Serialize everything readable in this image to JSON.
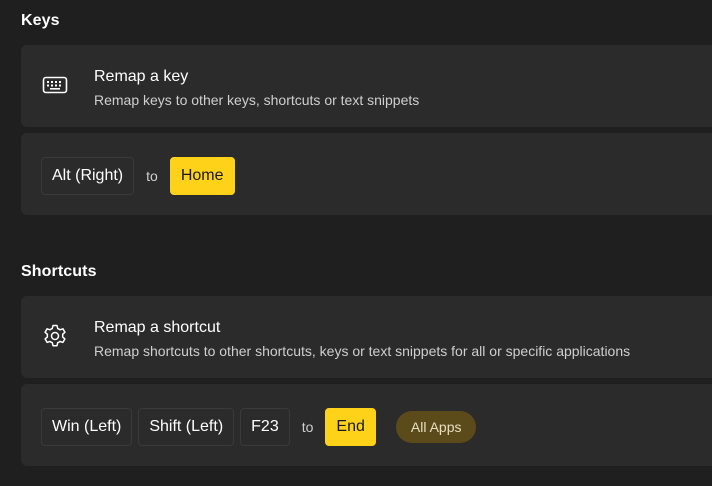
{
  "keys": {
    "section_title": "Keys",
    "card": {
      "icon": "keyboard-icon",
      "heading": "Remap a key",
      "description": "Remap keys to other keys, shortcuts or text snippets"
    },
    "mapping": {
      "source_keys": [
        "Alt (Right)"
      ],
      "connector": "to",
      "target_key": "Home"
    }
  },
  "shortcuts": {
    "section_title": "Shortcuts",
    "card": {
      "icon": "gear-icon",
      "heading": "Remap a shortcut",
      "description": "Remap shortcuts to other shortcuts, keys or text snippets for all or specific applications"
    },
    "mapping": {
      "source_keys": [
        "Win (Left)",
        "Shift (Left)",
        "F23"
      ],
      "connector": "to",
      "target_key": "End",
      "app_scope": "All Apps"
    }
  },
  "colors": {
    "background": "#1f1f1f",
    "card": "#2b2b2b",
    "target_key": "#ffd21a",
    "app_pill": "#5b4a1a"
  }
}
